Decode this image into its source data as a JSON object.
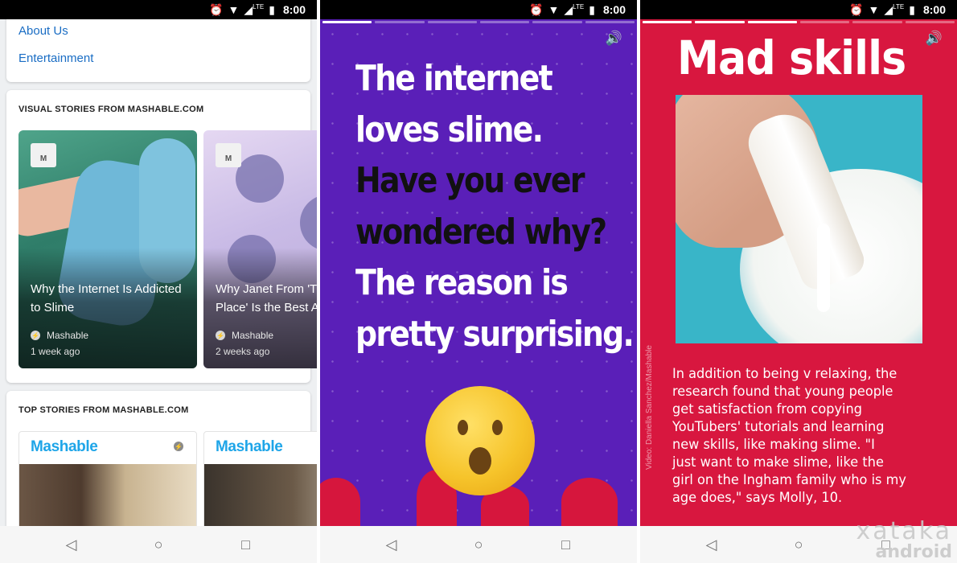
{
  "status_bar": {
    "time": "8:00",
    "network": "LTE"
  },
  "panel1": {
    "links": [
      "About Us",
      "Entertainment"
    ],
    "visual_stories": {
      "title": "VISUAL STORIES FROM MASHABLE.COM",
      "cards": [
        {
          "logo": "M",
          "headline_line1": "Why the Internet Is Addicted",
          "headline_line2": "to Slime",
          "publisher": "Mashable",
          "age": "1 week ago"
        },
        {
          "logo": "M",
          "headline_line1": "Why Janet From 'T",
          "headline_line2": "Place' Is the Best A",
          "publisher": "Mashable",
          "age": "2 weeks ago"
        }
      ]
    },
    "top_stories": {
      "title": "TOP STORIES FROM MASHABLE.COM",
      "cards": [
        {
          "brand": "Mashable"
        },
        {
          "brand": "Mashable"
        }
      ]
    }
  },
  "panel2": {
    "lines": [
      {
        "text": "The internet",
        "tone": "white"
      },
      {
        "text": "loves slime.",
        "tone": "white"
      },
      {
        "text": "Have you ever",
        "tone": "black"
      },
      {
        "text": "wondered why?",
        "tone": "black"
      },
      {
        "text": "The reason is",
        "tone": "white"
      },
      {
        "text": "pretty surprising.",
        "tone": "white"
      }
    ],
    "progress_segments": 6,
    "progress_done": 1
  },
  "panel3": {
    "title": "Mad skills",
    "credit": "Video: Daniella Sanchez/Mashable",
    "body_lines": [
      "In addition to being v relaxing, the",
      "research found that young people",
      "get satisfaction from copying",
      "YouTubers' tutorials and learning",
      "new skills, like making slime. \"I",
      "just want to make slime, like the",
      "girl on the Ingham family who is my",
      "age does,\" says Molly, 10."
    ],
    "progress_segments": 6,
    "progress_done": 3
  },
  "watermark": {
    "line1": "xataka",
    "line2": "android"
  },
  "colors": {
    "link": "#1a6dc4",
    "brand": "#1ea5e8",
    "story_purple": "#5a1fb8",
    "story_red": "#d8173f"
  }
}
